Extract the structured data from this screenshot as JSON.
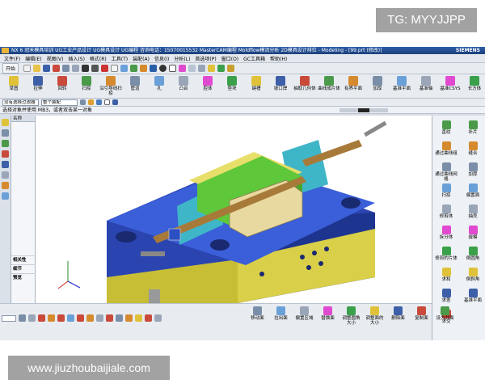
{
  "watermark_tag": "TG: MYYJJPP",
  "watermark_url": "www.jiuzhoubaijiale.com",
  "window": {
    "title": "NX 6 冠禾模具培训 UG工业产品设计 UG模具设计 UG编程 咨询电话：15070015532 MasterCAM编程 Moldflow模流分析 2D模具设计排位 - Modeling - [99.prt (修改)]",
    "brand": "SIEMENS"
  },
  "menu": [
    "文件(F)",
    "编辑(E)",
    "视图(V)",
    "插入(S)",
    "格式(R)",
    "工具(T)",
    "装配(A)",
    "信息(I)",
    "分析(L)",
    "首选项(P)",
    "窗口(O)",
    "GC工具箱",
    "帮助(H)"
  ],
  "toolbar1": {
    "start_label": "开始"
  },
  "toolbar2": [
    "草图",
    "拉伸",
    "回转",
    "扫掠",
    "沿引导线扫掠",
    "管道",
    "孔",
    "凸台",
    "腔体",
    "垫块",
    "键槽",
    "坡口焊",
    "抽取几何体",
    "曲线成片体",
    "有界平面",
    "加厚",
    "基准平面",
    "基准轴",
    "基准CSYS",
    "长方体"
  ],
  "filter": {
    "type_filter": "没有选择过滤器",
    "scope": "整个装配"
  },
  "cue": "选择对象并使用 MB3，或者双击某一对象",
  "navigator": {
    "header": "名称",
    "bottom_items": [
      "相关性",
      "细节",
      "预览"
    ]
  },
  "right_panel": [
    "直纹",
    "通过曲线组",
    "通过曲线网格",
    "扫掠",
    "修剪体",
    "拆分体",
    "修剪的片体",
    "求和",
    "求差",
    "求交",
    "补片",
    "缝合",
    "加厚",
    "偏置面",
    "抽壳",
    "拔模",
    "倒圆角",
    "倒斜角",
    "基准平面"
  ],
  "bottom_toolbar": [
    "移动面",
    "拉出面",
    "偏置区域",
    "替换面",
    "调整圆角大小",
    "调整面的大小",
    "删除面",
    "复制面",
    "设为共面"
  ],
  "colors": {
    "title_bar": "#1b3e7a",
    "mold_base": "#2c4fc2",
    "cavity_plate": "#e3d85a",
    "core_green": "#5fc73a",
    "slide_cyan": "#3fb6c8"
  }
}
